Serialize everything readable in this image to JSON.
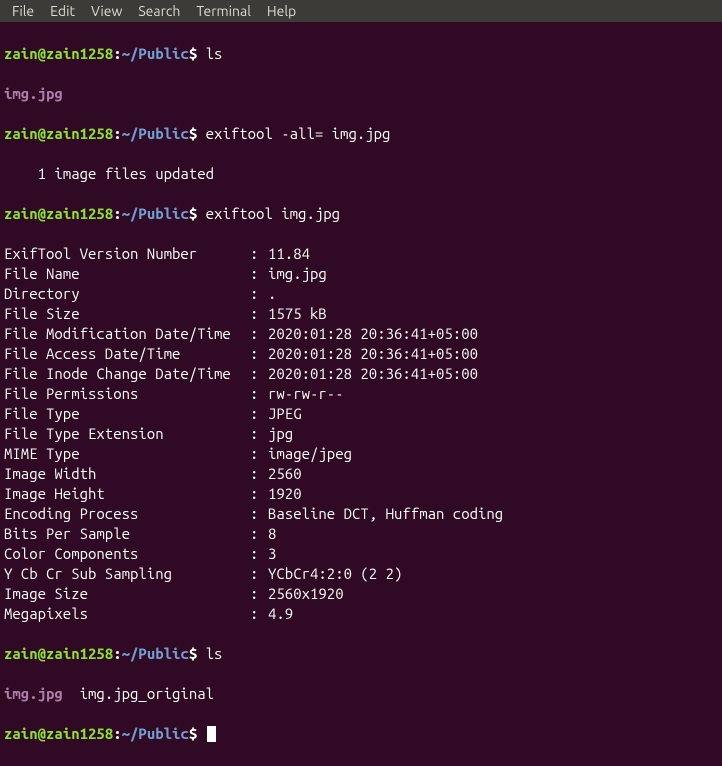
{
  "menubar": {
    "file": "File",
    "edit": "Edit",
    "view": "View",
    "search": "Search",
    "terminal": "Terminal",
    "help": "Help"
  },
  "prompt": {
    "user": "zain",
    "at": "@",
    "host": "zain1258",
    "colon": ":",
    "path": "~/Public",
    "dollar": "$"
  },
  "lines": {
    "c1": "ls",
    "o1": "img.jpg",
    "c2": "exiftool -all= img.jpg",
    "o2": "    1 image files updated",
    "c3": "exiftool img.jpg",
    "c4": "ls",
    "o4a": "img.jpg",
    "o4b": "  img.jpg_original",
    "c5": ""
  },
  "exif": [
    {
      "label": "ExifTool Version Number",
      "sep": ":",
      "value": "11.84"
    },
    {
      "label": "File Name",
      "sep": ":",
      "value": "img.jpg"
    },
    {
      "label": "Directory",
      "sep": ":",
      "value": "."
    },
    {
      "label": "File Size",
      "sep": ":",
      "value": "1575 kB"
    },
    {
      "label": "File Modification Date/Time",
      "sep": ":",
      "value": "2020:01:28 20:36:41+05:00"
    },
    {
      "label": "File Access Date/Time",
      "sep": ":",
      "value": "2020:01:28 20:36:41+05:00"
    },
    {
      "label": "File Inode Change Date/Time",
      "sep": ":",
      "value": "2020:01:28 20:36:41+05:00"
    },
    {
      "label": "File Permissions",
      "sep": ":",
      "value": "rw-rw-r--"
    },
    {
      "label": "File Type",
      "sep": ":",
      "value": "JPEG"
    },
    {
      "label": "File Type Extension",
      "sep": ":",
      "value": "jpg"
    },
    {
      "label": "MIME Type",
      "sep": ":",
      "value": "image/jpeg"
    },
    {
      "label": "Image Width",
      "sep": ":",
      "value": "2560"
    },
    {
      "label": "Image Height",
      "sep": ":",
      "value": "1920"
    },
    {
      "label": "Encoding Process",
      "sep": ":",
      "value": "Baseline DCT, Huffman coding"
    },
    {
      "label": "Bits Per Sample",
      "sep": ":",
      "value": "8"
    },
    {
      "label": "Color Components",
      "sep": ":",
      "value": "3"
    },
    {
      "label": "Y Cb Cr Sub Sampling",
      "sep": ":",
      "value": "YCbCr4:2:0 (2 2)"
    },
    {
      "label": "Image Size",
      "sep": ":",
      "value": "2560x1920"
    },
    {
      "label": "Megapixels",
      "sep": ":",
      "value": "4.9"
    }
  ]
}
